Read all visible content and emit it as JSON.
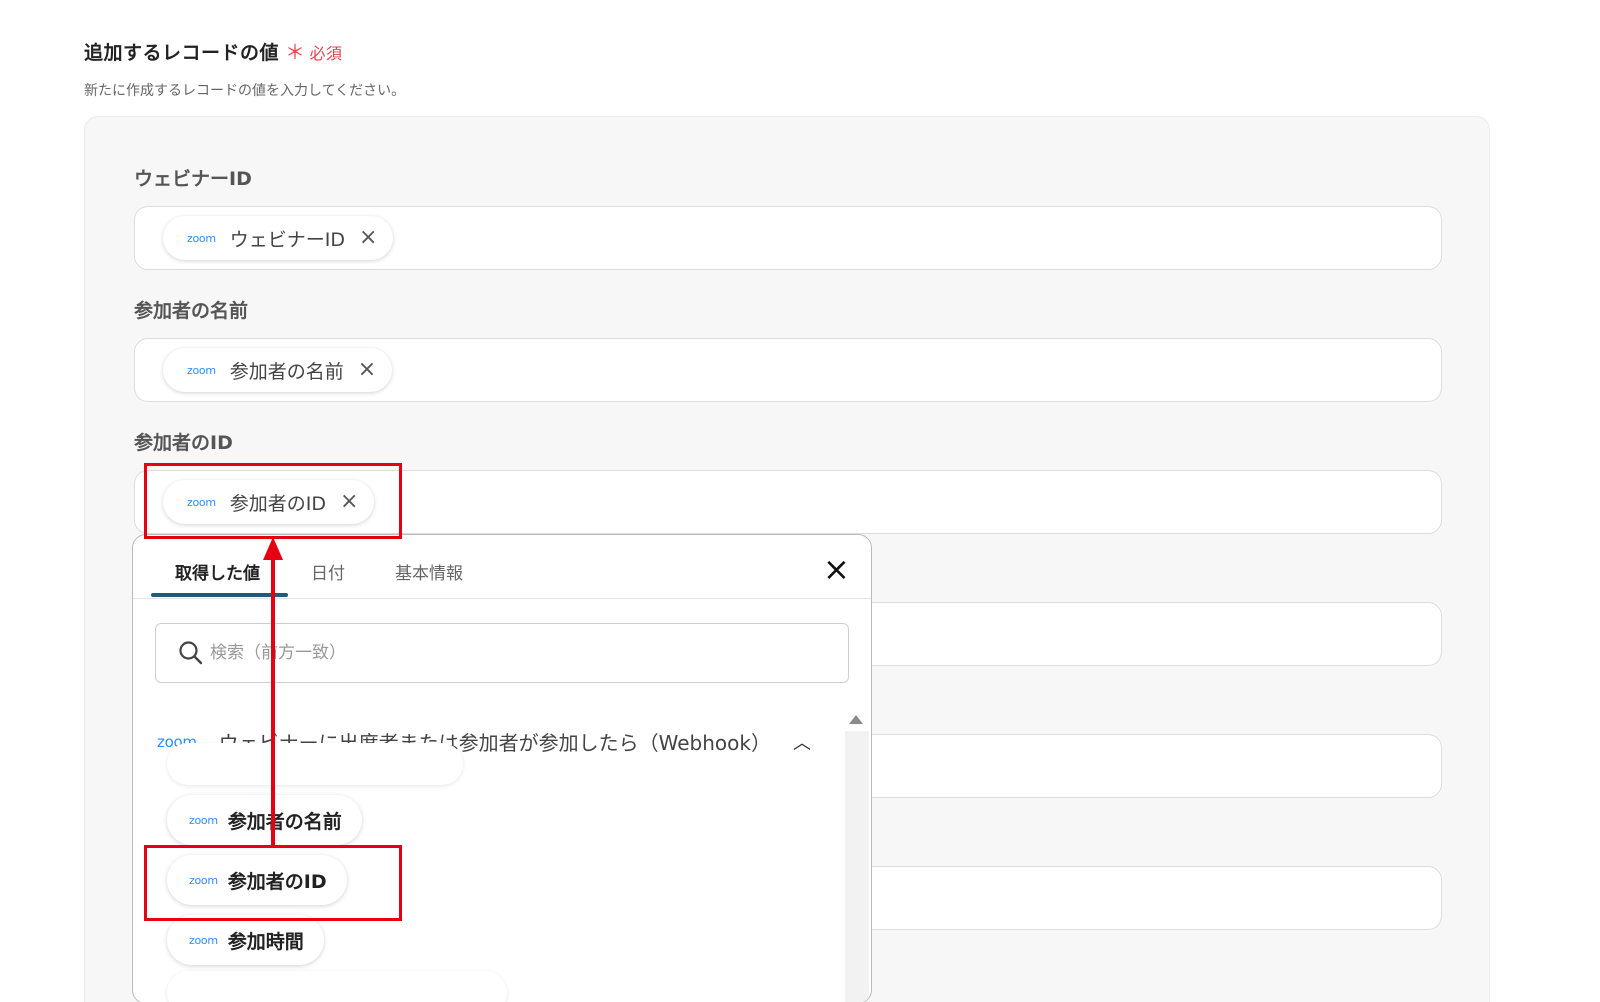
{
  "section": {
    "title": "追加するレコードの値",
    "required_mark": "＊",
    "required_label": "必須",
    "description": "新たに作成するレコードの値を入力してください。"
  },
  "fields": [
    {
      "label": "ウェビナーID",
      "chip": "ウェビナーID"
    },
    {
      "label": "参加者の名前",
      "chip": "参加者の名前"
    },
    {
      "label": "参加者のID",
      "chip": "参加者のID"
    }
  ],
  "icons": {
    "zoom_logo": "zoom",
    "remove": "×",
    "close": "×",
    "chevron_up": "︿"
  },
  "dropdown": {
    "tabs": [
      "取得した値",
      "日付",
      "基本情報"
    ],
    "search_placeholder": "検索（前方一致）",
    "group_title": "ウェビナーに出席者または参加者が参加したら（Webhook）",
    "options": [
      "参加者の名前",
      "参加者のID",
      "参加時間"
    ]
  },
  "colors": {
    "required": "#e8424d",
    "tab_underline": "#1d5c7a",
    "highlight": "#e50012",
    "zoom_brand": "#2d8cff"
  }
}
